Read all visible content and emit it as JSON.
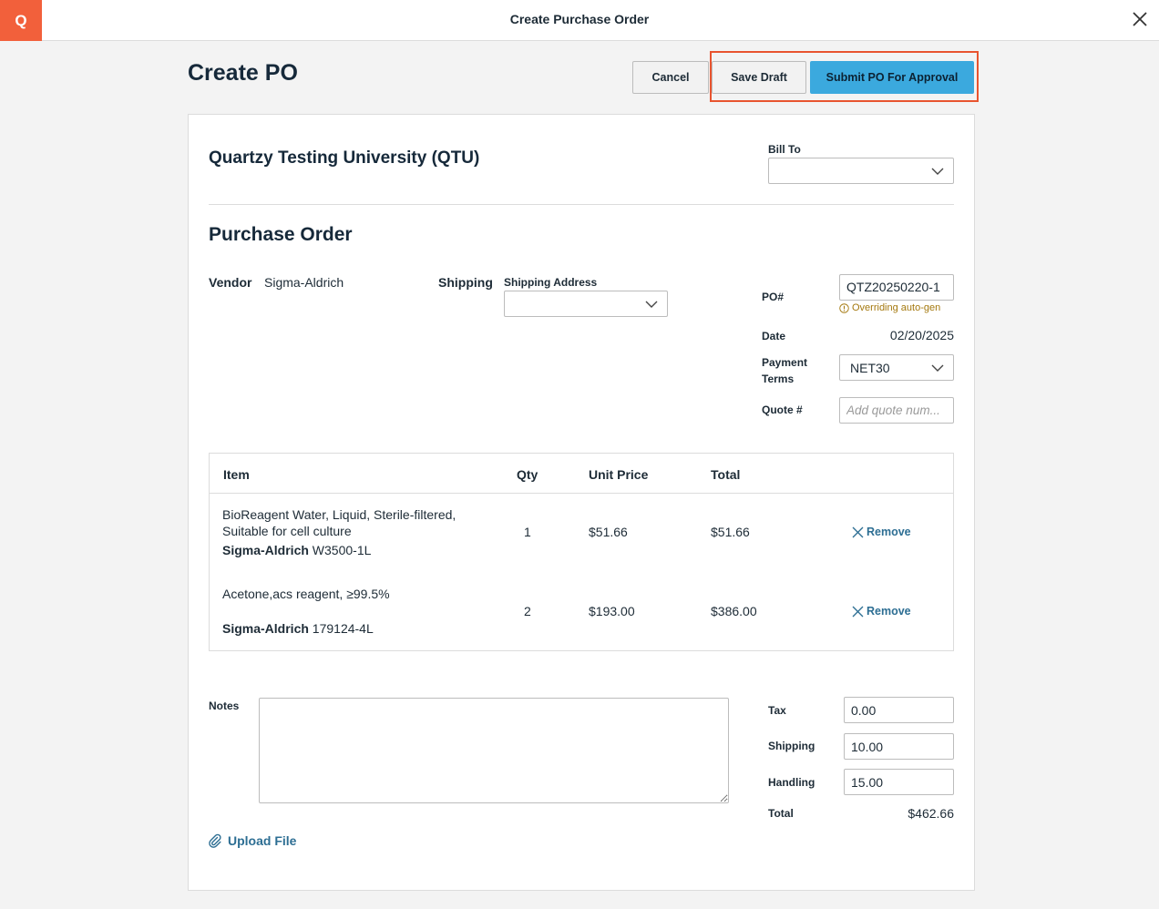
{
  "topbar": {
    "logo": "Q",
    "title": "Create Purchase Order",
    "close_icon": "close-icon"
  },
  "header": {
    "page_title": "Create PO",
    "cancel_label": "Cancel",
    "save_draft_label": "Save Draft",
    "submit_label": "Submit PO For Approval"
  },
  "org": {
    "name": "Quartzy Testing University (QTU)",
    "bill_to_label": "Bill To",
    "bill_to_value": ""
  },
  "po": {
    "heading": "Purchase Order",
    "vendor_label": "Vendor",
    "vendor_value": "Sigma-Aldrich",
    "shipping_label": "Shipping",
    "shipping_address_label": "Shipping Address",
    "shipping_address_value": "",
    "po_number_label": "PO#",
    "po_number_value": "QTZ20250220-1",
    "override_note": "Overriding auto-gen",
    "date_label": "Date",
    "date_value": "02/20/2025",
    "payment_terms_label": "Payment Terms",
    "payment_terms_value": "NET30",
    "quote_label": "Quote #",
    "quote_placeholder": "Add quote num..."
  },
  "table": {
    "headers": {
      "item": "Item",
      "qty": "Qty",
      "unit_price": "Unit Price",
      "total": "Total"
    },
    "rows": [
      {
        "name": "BioReagent Water, Liquid, Sterile-filtered, Suitable for cell culture",
        "vendor": "Sigma-Aldrich",
        "catalog": "W3500-1L",
        "qty": "1",
        "unit_price": "$51.66",
        "total": "$51.66",
        "remove_label": "Remove"
      },
      {
        "name": "Acetone,acs reagent, ≥99.5%",
        "vendor": "Sigma-Aldrich",
        "catalog": "179124-4L",
        "qty": "2",
        "unit_price": "$193.00",
        "total": "$386.00",
        "remove_label": "Remove"
      }
    ]
  },
  "footer": {
    "notes_label": "Notes",
    "notes_value": "",
    "upload_label": "Upload File",
    "tax_label": "Tax",
    "tax_value": "0.00",
    "shipping_label": "Shipping",
    "shipping_value": "10.00",
    "handling_label": "Handling",
    "handling_value": "15.00",
    "total_label": "Total",
    "total_value": "$462.66"
  },
  "colors": {
    "brand_orange": "#f2603b",
    "submit_blue": "#3ba9de",
    "highlight_red": "#e8542f",
    "link_blue": "#2d6e93",
    "warning_amber": "#a4780e"
  }
}
